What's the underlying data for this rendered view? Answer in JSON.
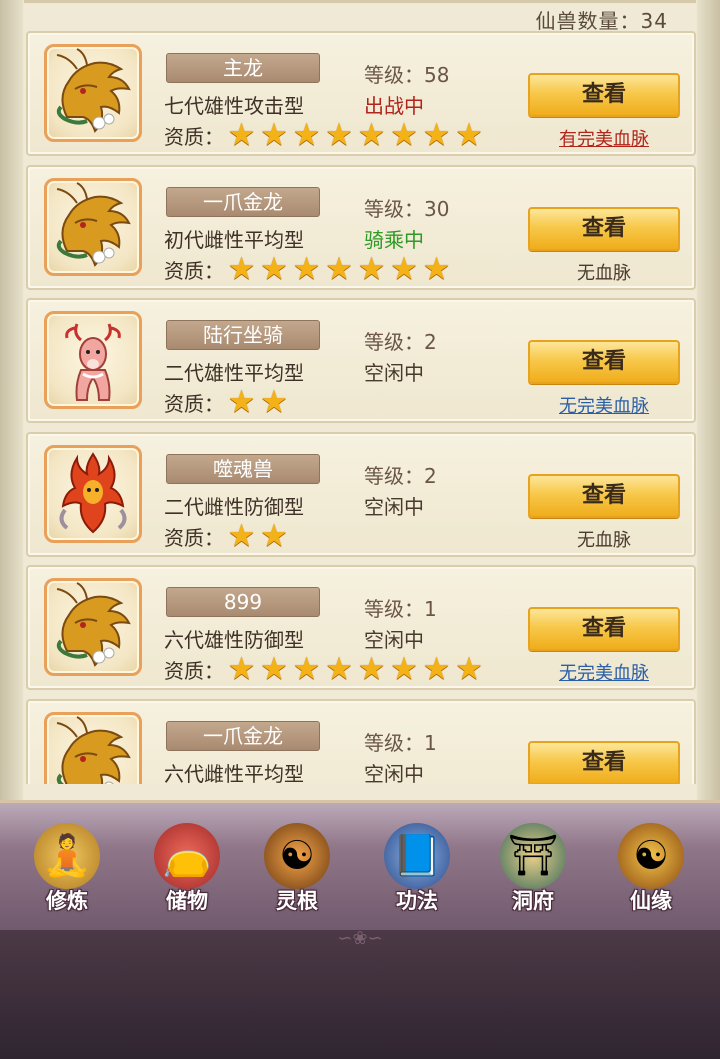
{
  "header": {
    "count_label": "仙兽数量：34"
  },
  "quality_label": "资质：",
  "view_label": "查看",
  "colors": {
    "status_battle": "#b2251d",
    "status_riding": "#2f9a26",
    "status_idle": "#4a3a2e",
    "bloodline_perfect": "#b2251d",
    "bloodline_none_perfect": "#2a5fa8",
    "bloodline_none": "#4a3a2e"
  },
  "pets": [
    {
      "name": "主龙",
      "level": "等级：58",
      "gen_type": "七代雄性攻击型",
      "status": "出战中",
      "status_kind": "battle",
      "stars": 8,
      "bloodline": "有完美血脉",
      "bloodline_kind": "perfect",
      "icon": "golden-dragon-icon"
    },
    {
      "name": "一爪金龙",
      "level": "等级：30",
      "gen_type": "初代雌性平均型",
      "status": "骑乘中",
      "status_kind": "riding",
      "stars": 7,
      "bloodline": "无血脉",
      "bloodline_kind": "none",
      "icon": "golden-dragon-icon"
    },
    {
      "name": "陆行坐骑",
      "level": "等级：2",
      "gen_type": "二代雄性平均型",
      "status": "空闲中",
      "status_kind": "idle",
      "stars": 2,
      "bloodline": "无完美血脉",
      "bloodline_kind": "none_perfect",
      "icon": "pink-deer-icon"
    },
    {
      "name": "噬魂兽",
      "level": "等级：2",
      "gen_type": "二代雌性防御型",
      "status": "空闲中",
      "status_kind": "idle",
      "stars": 2,
      "bloodline": "无血脉",
      "bloodline_kind": "none",
      "icon": "fire-spirit-icon"
    },
    {
      "name": "899",
      "level": "等级：1",
      "gen_type": "六代雄性防御型",
      "status": "空闲中",
      "status_kind": "idle",
      "stars": 8,
      "bloodline": "无完美血脉",
      "bloodline_kind": "none_perfect",
      "icon": "golden-dragon-icon"
    },
    {
      "name": "一爪金龙",
      "level": "等级：1",
      "gen_type": "六代雌性平均型",
      "status": "空闲中",
      "status_kind": "idle",
      "stars": 0,
      "bloodline": "",
      "bloodline_kind": "none",
      "icon": "golden-dragon-icon"
    }
  ],
  "nav": [
    {
      "label": "修炼",
      "icon": "meditating-monk-icon"
    },
    {
      "label": "储物",
      "icon": "storage-bag-icon"
    },
    {
      "label": "灵根",
      "icon": "spirit-root-icon"
    },
    {
      "label": "功法",
      "icon": "scripture-book-icon"
    },
    {
      "label": "洞府",
      "icon": "cave-palace-icon"
    },
    {
      "label": "仙缘",
      "icon": "gourd-icon"
    }
  ]
}
